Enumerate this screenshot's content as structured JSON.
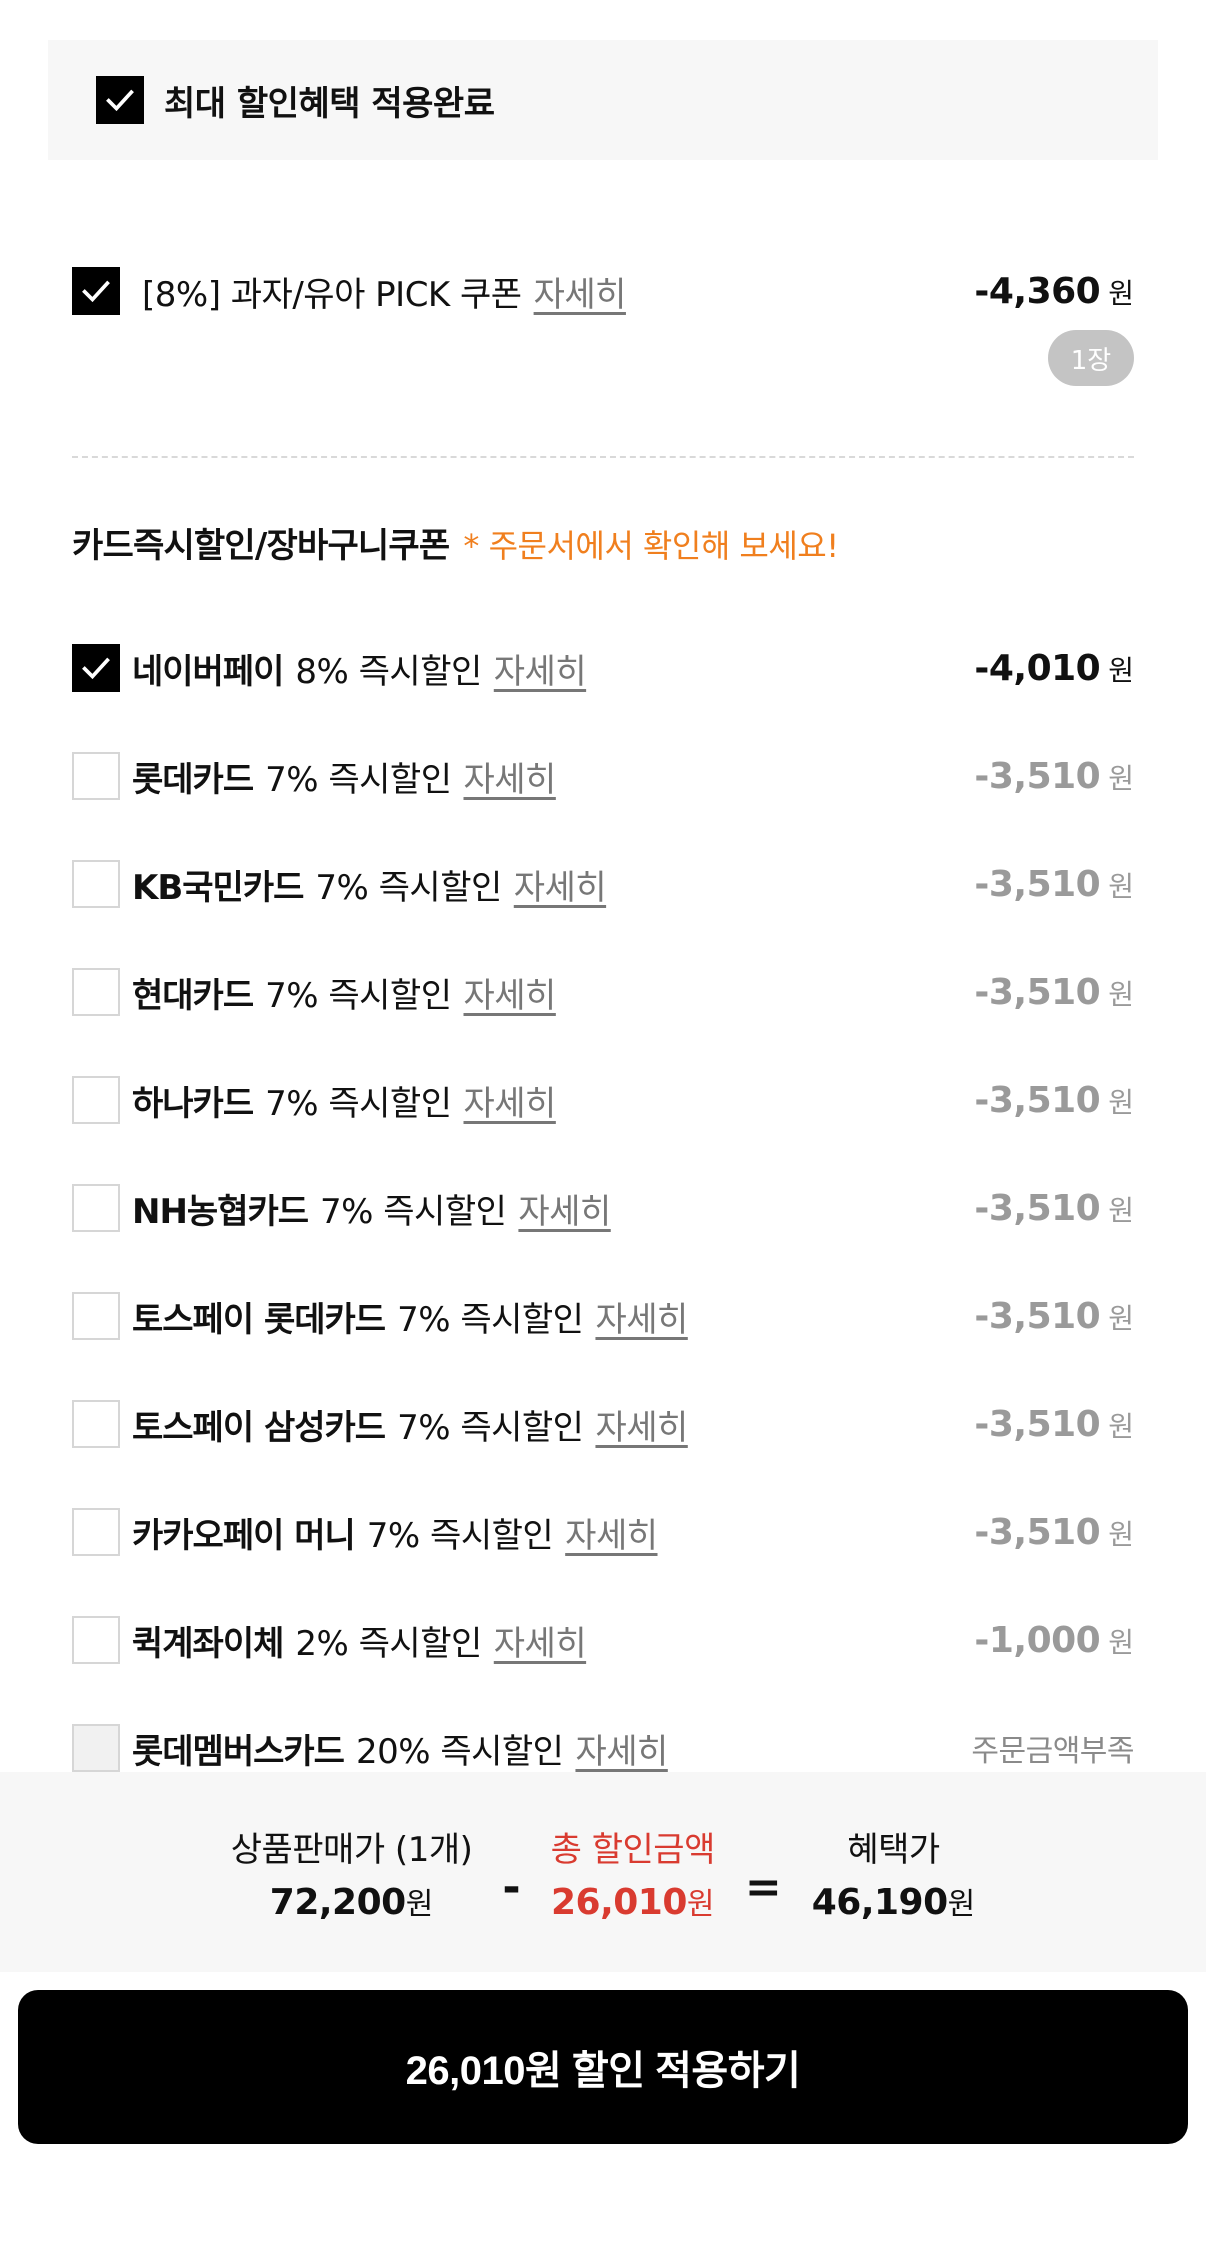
{
  "banner": {
    "label": "최대 할인혜택 적용완료",
    "checked": true
  },
  "coupon": {
    "label": "[8%] 과자/유아 PICK 쿠폰",
    "link": "자세히",
    "amount": "-4,360",
    "currency": "원",
    "quantity": "1장",
    "checked": true
  },
  "card_section": {
    "title": "카드즉시할인/장바구니쿠폰",
    "note": "* 주문서에서 확인해 보세요!"
  },
  "cards": [
    {
      "name": "네이버페이",
      "desc": "8% 즉시할인",
      "link": "자세히",
      "amount": "-4,010",
      "currency": "원",
      "state": "checked"
    },
    {
      "name": "롯데카드",
      "desc": "7% 즉시할인",
      "link": "자세히",
      "amount": "-3,510",
      "currency": "원",
      "state": "unchecked"
    },
    {
      "name": "KB국민카드",
      "desc": "7% 즉시할인",
      "link": "자세히",
      "amount": "-3,510",
      "currency": "원",
      "state": "unchecked"
    },
    {
      "name": "현대카드",
      "desc": "7% 즉시할인",
      "link": "자세히",
      "amount": "-3,510",
      "currency": "원",
      "state": "unchecked"
    },
    {
      "name": "하나카드",
      "desc": "7% 즉시할인",
      "link": "자세히",
      "amount": "-3,510",
      "currency": "원",
      "state": "unchecked"
    },
    {
      "name": "NH농협카드",
      "desc": "7% 즉시할인",
      "link": "자세히",
      "amount": "-3,510",
      "currency": "원",
      "state": "unchecked"
    },
    {
      "name": "토스페이 롯데카드",
      "desc": "7% 즉시할인",
      "link": "자세히",
      "amount": "-3,510",
      "currency": "원",
      "state": "unchecked"
    },
    {
      "name": "토스페이 삼성카드",
      "desc": "7% 즉시할인",
      "link": "자세히",
      "amount": "-3,510",
      "currency": "원",
      "state": "unchecked"
    },
    {
      "name": "카카오페이 머니",
      "desc": "7% 즉시할인",
      "link": "자세히",
      "amount": "-3,510",
      "currency": "원",
      "state": "unchecked"
    },
    {
      "name": "퀵계좌이체",
      "desc": "2% 즉시할인",
      "link": "자세히",
      "amount": "-1,000",
      "currency": "원",
      "state": "unchecked"
    },
    {
      "name": "롯데멤버스카드",
      "desc": "20% 즉시할인",
      "link": "자세히",
      "status": "주문금액부족",
      "state": "disabled"
    }
  ],
  "summary": {
    "price_label": "상품판매가 (1개)",
    "price_value": "72,200",
    "minus": "-",
    "discount_label": "총 할인금액",
    "discount_value": "26,010",
    "equals": "=",
    "final_label": "혜택가",
    "final_value": "46,190",
    "currency": "원"
  },
  "apply_button": {
    "label": "26,010원 할인 적용하기"
  },
  "colors": {
    "accent_orange": "#f07f1e",
    "discount_red": "#d93b30",
    "button_bg": "#000000"
  }
}
